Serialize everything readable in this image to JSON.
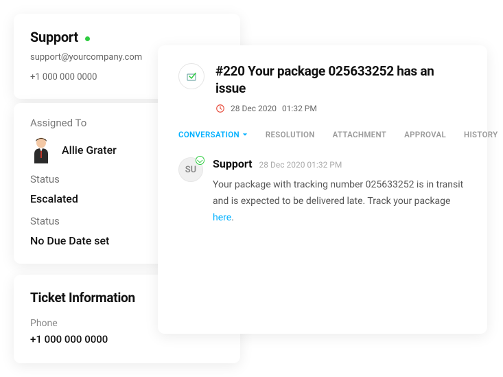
{
  "support": {
    "title": "Support",
    "email": "support@yourcompany.com",
    "phone": "+1 000 000 0000"
  },
  "assigned": {
    "label": "Assigned To",
    "name": "Allie Grater",
    "status_label": "Status",
    "status_value": "Escalated",
    "due_label": "Status",
    "due_value": "No Due Date set"
  },
  "info": {
    "title": "Ticket Information",
    "phone_label": "Phone",
    "phone_value": "+1 000 000 0000"
  },
  "ticket": {
    "title": "#220 Your package 025633252 has an issue",
    "date": "28 Dec 2020",
    "time": "01:32 PM",
    "tabs": {
      "conversation": "CONVERSATION",
      "resolution": "RESOLUTION",
      "attachment": "ATTACHMENT",
      "approval": "APPROVAL",
      "history": "HISTORY"
    },
    "message": {
      "avatar_initials": "SU",
      "author": "Support",
      "timestamp": "28 Dec 2020 01:32 PM",
      "body_before": "Your package with tracking number 025633252 is in transit and is expected to be delivered late. Track your package ",
      "body_link": "here",
      "body_after": "."
    }
  }
}
